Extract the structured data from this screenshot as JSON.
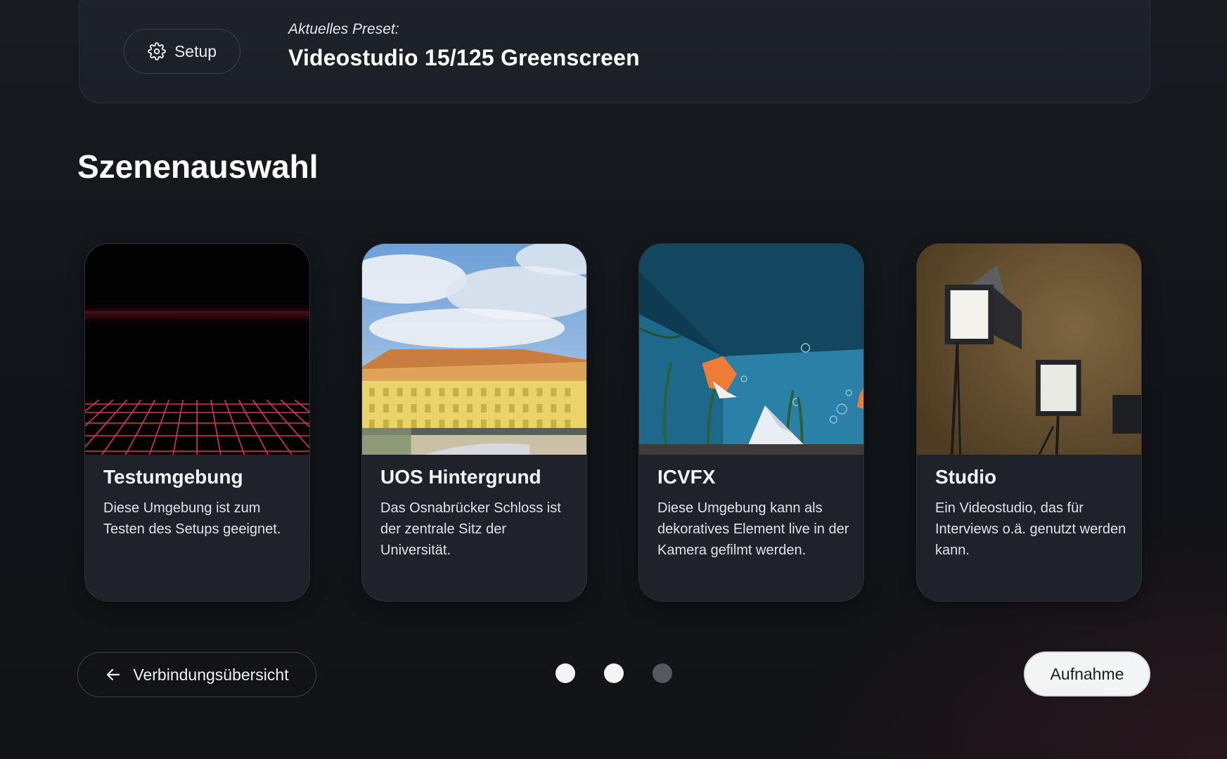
{
  "header": {
    "setup_label": "Setup",
    "preset_caption": "Aktuelles Preset:",
    "preset_name": "Videostudio 15/125 Greenscreen"
  },
  "section_title": "Szenenauswahl",
  "scenes": [
    {
      "title": "Testumgebung",
      "description": "Diese Umgebung ist zum Testen des Setups geeignet."
    },
    {
      "title": "UOS Hintergrund",
      "description": "Das Osnabrücker Schloss ist der zentrale Sitz der Universität."
    },
    {
      "title": "ICVFX",
      "description": "Diese Umgebung kann als dekoratives Element live in der Kamera gefilmt werden."
    },
    {
      "title": "Studio",
      "description": "Ein Videostudio, das für Interviews o.ä. genutzt werden kann."
    }
  ],
  "footer": {
    "back_label": "Verbindungsübersicht",
    "record_label": "Aufnahme",
    "pagination": {
      "pages": 3,
      "active_states": [
        true,
        true,
        false
      ]
    }
  },
  "icons": {
    "setup": "gear-icon",
    "back": "arrow-left-icon"
  },
  "colors": {
    "accent_grid": "#e0394d",
    "dot_active": "#f4f4f4",
    "dot_inactive": "#55595f",
    "record_bg": "#f3f4f6"
  }
}
